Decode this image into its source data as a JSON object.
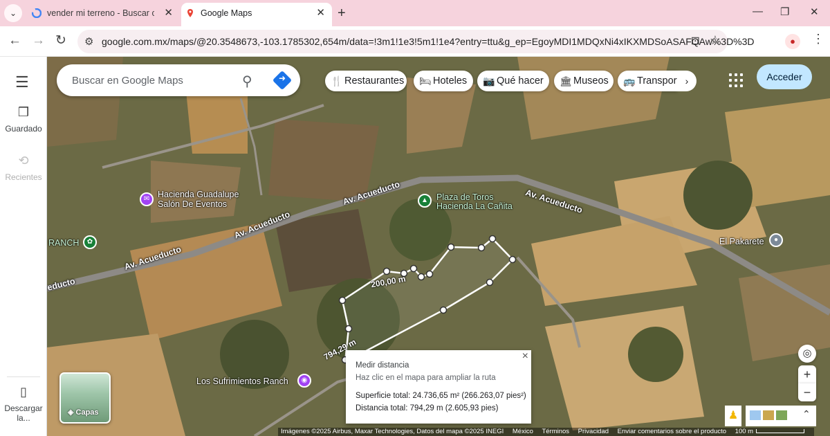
{
  "browser": {
    "tabs": [
      {
        "title": "vender mi terreno - Buscar con Google",
        "icon": "google-icon"
      },
      {
        "title": "Google Maps",
        "icon": "maps-pin-icon"
      }
    ],
    "url": "google.com.mx/maps/@20.3548673,-103.1785302,654m/data=!3m1!1e3!5m1!1e4?entry=ttu&g_ep=EgoyMDI1MDQxNi4xIKXMDSoASAFQAw%3D%3D"
  },
  "rail": {
    "saved": "Guardado",
    "recent": "Recientes",
    "download": "Descargar la..."
  },
  "search": {
    "placeholder": "Buscar en Google Maps"
  },
  "chips": [
    "Restaurantes",
    "Hoteles",
    "Qué hacer",
    "Museos",
    "Transporte"
  ],
  "signin": "Acceder",
  "map_labels": {
    "hacienda_guadalupe": "Hacienda Guadalupe Salón De Eventos",
    "plaza_toros": "Plaza de Toros Hacienda La Cañita",
    "ranch": "RANCH",
    "el_pakarete": "El Pakarete",
    "sufrimientos": "Los Sufrimientos Ranch",
    "road": "Av. Acueducto",
    "road_left": "educto"
  },
  "measure_labels": {
    "segment": "200,00 m",
    "side": "794,29 m"
  },
  "measure_panel": {
    "title": "Medir distancia",
    "hint": "Haz clic en el mapa para ampliar la ruta",
    "area": "Superficie total: 24.736,65 m² (266.263,07 pies²)",
    "distance": "Distancia total: 794,29 m (2.605,93 pies)"
  },
  "layers_label": "Capas",
  "footer": {
    "imagery": "Imágenes ©2025 Airbus, Maxar Technologies, Datos del mapa ©2025 INEGI",
    "country": "México",
    "terms": "Términos",
    "privacy": "Privacidad",
    "feedback": "Enviar comentarios sobre el producto",
    "scale": "100 m"
  },
  "colors": {
    "accent": "#1a73e8",
    "signin_bg": "#c2e7ff",
    "tabbar": "#f6d3dd",
    "poi_purple": "#a142f4",
    "poi_green": "#188038"
  }
}
